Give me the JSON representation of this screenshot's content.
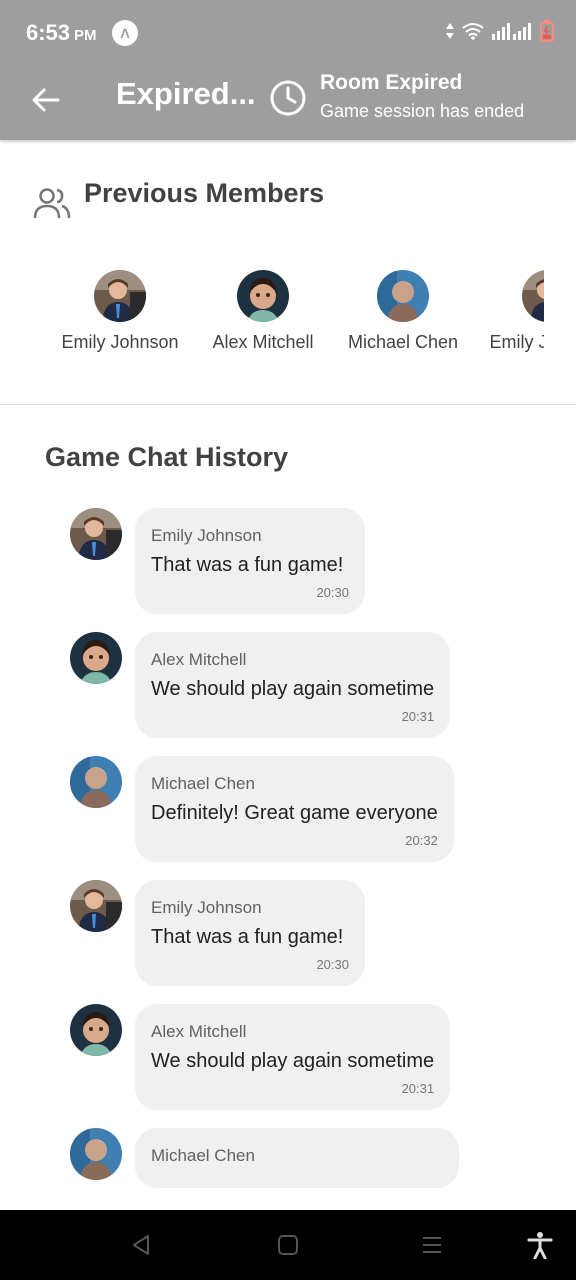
{
  "status_bar": {
    "time": "6:53",
    "ampm": "PM",
    "app_icon_glyph": "Λ"
  },
  "header": {
    "title": "Expired...",
    "room_status_title": "Room Expired",
    "room_status_subtitle": "Game session has ended"
  },
  "members": {
    "title": "Previous Members",
    "items": [
      {
        "name": "Emily Johnson",
        "avatar": "avatar-emily"
      },
      {
        "name": "Alex Mitchell",
        "avatar": "avatar-alex"
      },
      {
        "name": "Michael Chen",
        "avatar": "avatar-michael"
      },
      {
        "name": "Emily Johnson",
        "avatar": "avatar-emily"
      }
    ]
  },
  "chat": {
    "title": "Game Chat History",
    "messages": [
      {
        "sender": "Emily Johnson",
        "text": "That was a fun game!",
        "time": "20:30"
      },
      {
        "sender": "Alex Mitchell",
        "text": "We should play again sometime",
        "time": "20:31"
      },
      {
        "sender": "Michael Chen",
        "text": "Definitely! Great game everyone",
        "time": "20:32"
      },
      {
        "sender": "Emily Johnson",
        "text": "That was a fun game!",
        "time": "20:30"
      },
      {
        "sender": "Alex Mitchell",
        "text": "We should play again sometime",
        "time": "20:31"
      },
      {
        "sender": "Michael Chen",
        "text": "",
        "time": ""
      }
    ]
  },
  "colors": {
    "header_bg": "#9e9e9e",
    "bubble_bg": "#f0f0f0",
    "text_dark": "#424242"
  }
}
